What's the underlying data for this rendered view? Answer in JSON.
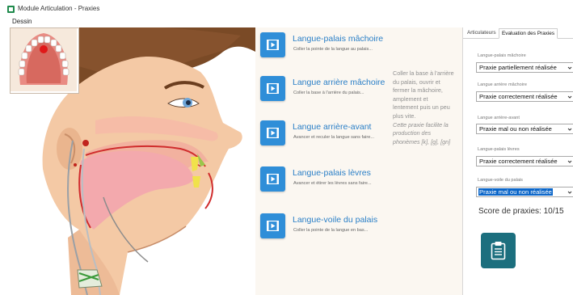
{
  "window": {
    "title": "Module Articulation - Praxies"
  },
  "menu": {
    "items": [
      "Dessin"
    ]
  },
  "exercises": [
    {
      "title": "Langue-palais mâchoire",
      "desc": "Coller la pointe de la langue au palais..."
    },
    {
      "title": "Langue arrière mâchoire",
      "desc": "Coller la base à l'arrière du palais..."
    },
    {
      "title": "Langue arrière-avant",
      "desc": "Avancer et reculer la langue sans faire..."
    },
    {
      "title": "Langue-palais lèvres",
      "desc": "Avancer et étirer les lèvres sans faire..."
    },
    {
      "title": "Langue-voile du palais",
      "desc": "Coller la pointe de la langue en bas..."
    }
  ],
  "tip": {
    "lines": [
      "Coller la base à l'arrière",
      "du palais, ouvrir et",
      "fermer la mâchoire,",
      "amplement et",
      "lentement puis un peu",
      "plus vite."
    ],
    "italic_lines": [
      "Cette praxie facilite la",
      "production des",
      "phonèmes [k], [g], [gn]"
    ]
  },
  "tabs": [
    "Articulateurs",
    "Evaluation des Praxies"
  ],
  "evaluations": [
    {
      "label": "Langue-palais mâchoire",
      "value": "Praxie partiellement réalisée"
    },
    {
      "label": "Langue arrière mâchoire",
      "value": "Praxie correctement réalisée"
    },
    {
      "label": "Langue arrière-avant",
      "value": "Praxie mal ou non réalisée"
    },
    {
      "label": "Langue-palais lèvres",
      "value": "Praxie correctement réalisée"
    },
    {
      "label": "Langue-voile du palais",
      "value": "Praxie mal ou non réalisée"
    }
  ],
  "score": {
    "text": "Score de praxies: 10/15"
  },
  "colors": {
    "accent": "#2f8ed8",
    "selected": "#0b66c9",
    "report_button": "#1c6f7e",
    "exercise_bg": "#fbf7f1"
  },
  "icons": {
    "window": "app-icon",
    "exercise": "video-play-icon",
    "report": "clipboard-icon",
    "dropdown": "chevron-down-icon"
  }
}
